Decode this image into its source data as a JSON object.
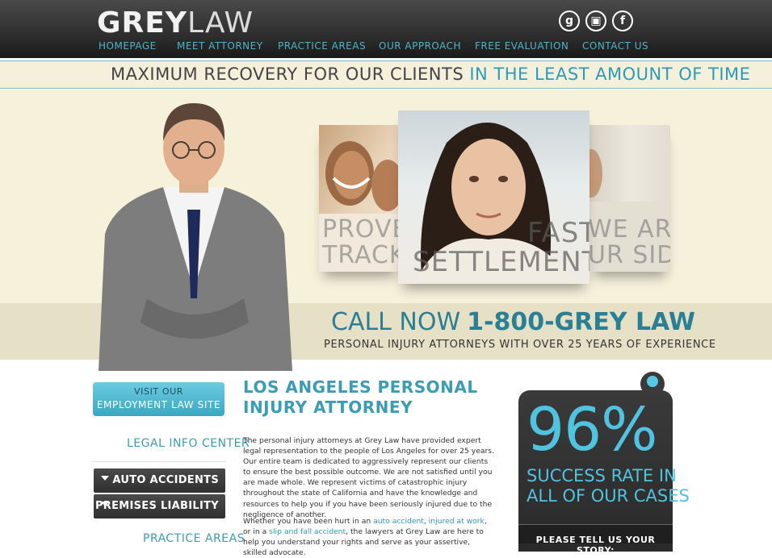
{
  "header": {
    "logo_bold": "GREY",
    "logo_light": "LAW",
    "nav": [
      "HOMEPAGE",
      "MEET ATTORNEY",
      "PRACTICE AREAS",
      "OUR APPROACH",
      "FREE EVALUATION",
      "CONTACT US"
    ],
    "social": [
      {
        "icon": "google-icon",
        "glyph": "g"
      },
      {
        "icon": "instagram-icon",
        "glyph": "▣"
      },
      {
        "icon": "facebook-icon",
        "glyph": "f"
      }
    ]
  },
  "tagline": {
    "dark": "MAXIMUM RECOVERY FOR OUR CLIENTS",
    "blue": "IN THE LEAST AMOUNT OF TIME"
  },
  "hero": {
    "slides": [
      {
        "line1": "PROVEN",
        "line2": "TRACK R"
      },
      {
        "line1": "FAST",
        "line2": "SETTLEMENTS"
      },
      {
        "line1": "WE ARE",
        "line2": "UR SIDE"
      }
    ],
    "call_prefix": "CALL NOW",
    "call_number": "1-800-GREY LAW",
    "subline": "PERSONAL INJURY ATTORNEYS WITH OVER 25 YEARS OF EXPERIENCE"
  },
  "sidebar": {
    "employment_line1": "VISIT OUR",
    "employment_line2": "EMPLOYMENT LAW SITE",
    "legal_info": "LEGAL INFO CENTER",
    "buttons": [
      "AUTO ACCIDENTS",
      "PREMISES LIABILITY"
    ],
    "practice_areas": "PRACTICE AREAS"
  },
  "main": {
    "title": "LOS ANGELES PERSONAL INJURY ATTORNEY",
    "paragraph1": "The personal injury attorneys at Grey Law have provided expert legal representation to the people of Los Angeles for over 25 years.  Our entire team is dedicated to aggressively represent our clients to ensure the best possible outcome.  We are not satisfied until you are made whole.  We represent victims of catastrophic injury throughout the state of California and have the knowledge and resources to help you if you have been seriously injured due to the negligence of another.",
    "p2_a": "Whether you have been hurt in an ",
    "p2_link1": "auto accident",
    "p2_b": ", ",
    "p2_link2": "injured at work",
    "p2_c": ", or in a ",
    "p2_link3": "slip and fall accident",
    "p2_d": ", the lawyers at Grey Law are here to help you understand your rights and serve as your assertive, skilled advocate."
  },
  "stat": {
    "percent": "96%",
    "line1": "SUCCESS RATE IN",
    "line2": "ALL OF OUR CASES",
    "story": "PLEASE TELL US YOUR STORY:"
  },
  "colors": {
    "accent": "#3b9cb5",
    "header_dark": "#2b2b2b",
    "cream": "#f5f1db",
    "stat_blue": "#4fc3e0"
  }
}
